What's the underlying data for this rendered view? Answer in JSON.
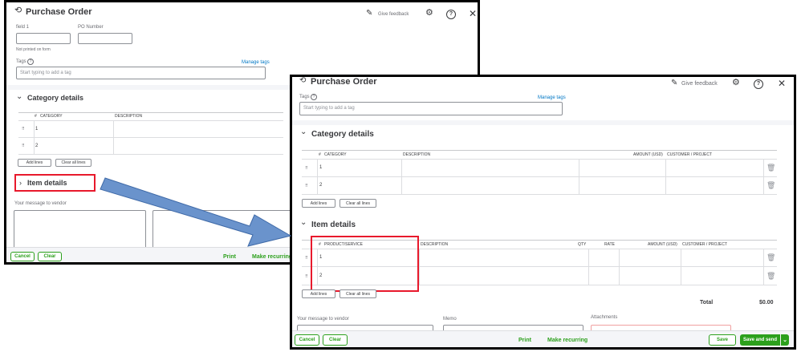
{
  "window1": {
    "title": "Purchase Order",
    "give_feedback": "Give feedback",
    "field1_label": "field 1",
    "po_number_label": "PO Number",
    "note": "Not printed on form",
    "tags_label": "Tags",
    "manage_tags": "Manage tags",
    "tags_placeholder": "Start typing to add a tag",
    "category_details": "Category details",
    "col_num": "#",
    "col_category": "CATEGORY",
    "col_description": "DESCRIPTION",
    "rows": [
      "1",
      "2"
    ],
    "add_lines": "Add lines",
    "clear_all_lines": "Clear all lines",
    "item_details": "Item details",
    "message_label": "Your message to vendor",
    "cancel": "Cancel",
    "clear": "Clear",
    "print": "Print",
    "make_recurring": "Make recurring"
  },
  "window2": {
    "title": "Purchase Order",
    "give_feedback": "Give feedback",
    "tags_label": "Tags",
    "manage_tags": "Manage tags",
    "tags_placeholder": "Start typing to add a tag",
    "category_details": "Category details",
    "cat_cols": {
      "num": "#",
      "category": "CATEGORY",
      "description": "DESCRIPTION",
      "amount": "AMOUNT (USD)",
      "customer": "CUSTOMER / PROJECT"
    },
    "rows": [
      "1",
      "2"
    ],
    "add_lines": "Add lines",
    "clear_all_lines": "Clear all lines",
    "item_details": "Item details",
    "item_cols": {
      "num": "#",
      "product": "PRODUCT/SERVICE",
      "description": "DESCRIPTION",
      "qty": "QTY",
      "rate": "RATE",
      "amount": "AMOUNT (USD)",
      "customer": "CUSTOMER / PROJECT"
    },
    "total_label": "Total",
    "total_value": "$0.00",
    "message_label": "Your message to vendor",
    "memo_label": "Memo",
    "attachments_label": "Attachments",
    "cancel": "Cancel",
    "clear": "Clear",
    "print": "Print",
    "make_recurring": "Make recurring",
    "save": "Save",
    "save_and_send": "Save and send"
  },
  "colors": {
    "accent_green": "#2ca01c",
    "highlight_red": "#e8192c",
    "arrow_blue": "#6a93cc"
  }
}
